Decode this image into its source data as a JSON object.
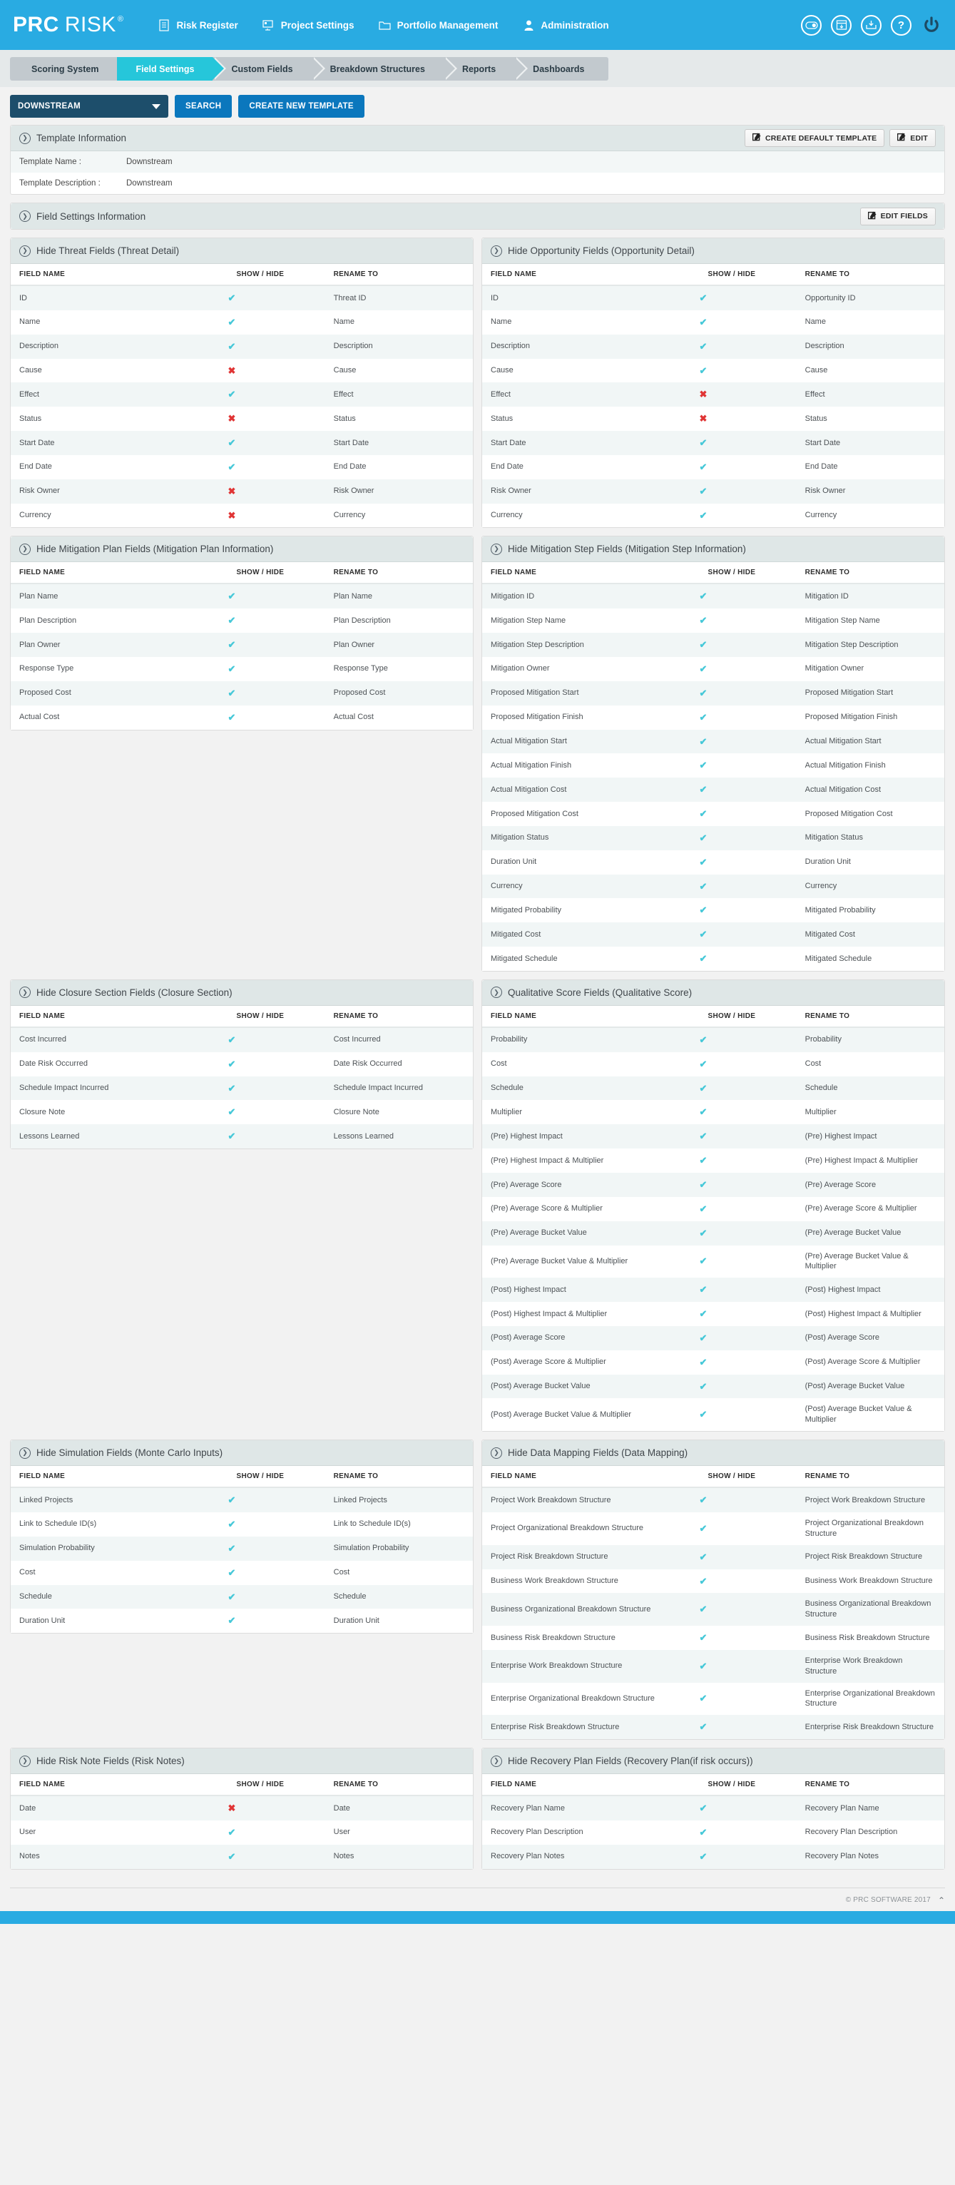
{
  "brand": {
    "part1": "PRC",
    "part2": "RISK",
    "registered": "®"
  },
  "nav": {
    "items": [
      {
        "label": "Risk Register",
        "icon": "document-list-icon"
      },
      {
        "label": "Project Settings",
        "icon": "project-settings-icon"
      },
      {
        "label": "Portfolio Management",
        "icon": "folder-icon"
      },
      {
        "label": "Administration",
        "icon": "user-icon"
      }
    ],
    "tools": [
      {
        "name": "toggle-switch-icon"
      },
      {
        "name": "calendar-download-icon"
      },
      {
        "name": "inbox-download-icon"
      },
      {
        "name": "help-icon"
      },
      {
        "name": "power-icon"
      }
    ]
  },
  "tabs": [
    {
      "label": "Scoring System",
      "active": false
    },
    {
      "label": "Field Settings",
      "active": true
    },
    {
      "label": "Custom Fields",
      "active": false
    },
    {
      "label": "Breakdown Structures",
      "active": false
    },
    {
      "label": "Reports",
      "active": false
    },
    {
      "label": "Dashboards",
      "active": false
    }
  ],
  "actionbar": {
    "selected_template": "DOWNSTREAM",
    "search_label": "SEARCH",
    "create_label": "CREATE NEW TEMPLATE"
  },
  "template_info": {
    "title": "Template Information",
    "create_default_label": "CREATE DEFAULT TEMPLATE",
    "edit_label": "EDIT",
    "rows": [
      {
        "label": "Template Name :",
        "value": "Downstream"
      },
      {
        "label": "Template Description :",
        "value": "Downstream"
      }
    ]
  },
  "field_settings": {
    "title": "Field Settings Information",
    "edit_fields_label": "EDIT FIELDS"
  },
  "columns": [
    "FIELD NAME",
    "SHOW / HIDE",
    "RENAME TO"
  ],
  "sections": [
    {
      "id": "threat",
      "title": "Hide Threat Fields (Threat Detail)",
      "rows": [
        {
          "field": "ID",
          "show": true,
          "rename": "Threat ID"
        },
        {
          "field": "Name",
          "show": true,
          "rename": "Name"
        },
        {
          "field": "Description",
          "show": true,
          "rename": "Description"
        },
        {
          "field": "Cause",
          "show": false,
          "rename": "Cause"
        },
        {
          "field": "Effect",
          "show": true,
          "rename": "Effect"
        },
        {
          "field": "Status",
          "show": false,
          "rename": "Status"
        },
        {
          "field": "Start Date",
          "show": true,
          "rename": "Start Date"
        },
        {
          "field": "End Date",
          "show": true,
          "rename": "End Date"
        },
        {
          "field": "Risk Owner",
          "show": false,
          "rename": "Risk Owner"
        },
        {
          "field": "Currency",
          "show": false,
          "rename": "Currency"
        }
      ]
    },
    {
      "id": "opportunity",
      "title": "Hide Opportunity Fields (Opportunity Detail)",
      "rows": [
        {
          "field": "ID",
          "show": true,
          "rename": "Opportunity ID"
        },
        {
          "field": "Name",
          "show": true,
          "rename": "Name"
        },
        {
          "field": "Description",
          "show": true,
          "rename": "Description"
        },
        {
          "field": "Cause",
          "show": true,
          "rename": "Cause"
        },
        {
          "field": "Effect",
          "show": false,
          "rename": "Effect"
        },
        {
          "field": "Status",
          "show": false,
          "rename": "Status"
        },
        {
          "field": "Start Date",
          "show": true,
          "rename": "Start Date"
        },
        {
          "field": "End Date",
          "show": true,
          "rename": "End Date"
        },
        {
          "field": "Risk Owner",
          "show": true,
          "rename": "Risk Owner"
        },
        {
          "field": "Currency",
          "show": true,
          "rename": "Currency"
        }
      ]
    },
    {
      "id": "mitigation-plan",
      "title": "Hide Mitigation Plan Fields (Mitigation Plan Information)",
      "rows": [
        {
          "field": "Plan Name",
          "show": true,
          "rename": "Plan Name"
        },
        {
          "field": "Plan Description",
          "show": true,
          "rename": "Plan Description"
        },
        {
          "field": "Plan Owner",
          "show": true,
          "rename": "Plan Owner"
        },
        {
          "field": "Response Type",
          "show": true,
          "rename": "Response Type"
        },
        {
          "field": "Proposed Cost",
          "show": true,
          "rename": "Proposed Cost"
        },
        {
          "field": "Actual Cost",
          "show": true,
          "rename": "Actual Cost"
        }
      ]
    },
    {
      "id": "mitigation-step",
      "title": "Hide Mitigation Step Fields (Mitigation Step Information)",
      "rows": [
        {
          "field": "Mitigation ID",
          "show": true,
          "rename": "Mitigation ID"
        },
        {
          "field": "Mitigation Step Name",
          "show": true,
          "rename": "Mitigation Step Name"
        },
        {
          "field": "Mitigation Step Description",
          "show": true,
          "rename": "Mitigation Step Description"
        },
        {
          "field": "Mitigation Owner",
          "show": true,
          "rename": "Mitigation Owner"
        },
        {
          "field": "Proposed Mitigation Start",
          "show": true,
          "rename": "Proposed Mitigation Start"
        },
        {
          "field": "Proposed Mitigation Finish",
          "show": true,
          "rename": "Proposed Mitigation Finish"
        },
        {
          "field": "Actual Mitigation Start",
          "show": true,
          "rename": "Actual Mitigation Start"
        },
        {
          "field": "Actual Mitigation Finish",
          "show": true,
          "rename": "Actual Mitigation Finish"
        },
        {
          "field": "Actual Mitigation Cost",
          "show": true,
          "rename": "Actual Mitigation Cost"
        },
        {
          "field": "Proposed Mitigation Cost",
          "show": true,
          "rename": "Proposed Mitigation Cost"
        },
        {
          "field": "Mitigation Status",
          "show": true,
          "rename": "Mitigation Status"
        },
        {
          "field": "Duration Unit",
          "show": true,
          "rename": "Duration Unit"
        },
        {
          "field": "Currency",
          "show": true,
          "rename": "Currency"
        },
        {
          "field": "Mitigated Probability",
          "show": true,
          "rename": "Mitigated Probability"
        },
        {
          "field": "Mitigated Cost",
          "show": true,
          "rename": "Mitigated Cost"
        },
        {
          "field": "Mitigated Schedule",
          "show": true,
          "rename": "Mitigated Schedule"
        }
      ]
    },
    {
      "id": "closure-section",
      "title": "Hide Closure Section Fields (Closure Section)",
      "rows": [
        {
          "field": "Cost Incurred",
          "show": true,
          "rename": "Cost Incurred"
        },
        {
          "field": "Date Risk Occurred",
          "show": true,
          "rename": "Date Risk Occurred"
        },
        {
          "field": "Schedule Impact Incurred",
          "show": true,
          "rename": "Schedule Impact Incurred"
        },
        {
          "field": "Closure Note",
          "show": true,
          "rename": "Closure Note"
        },
        {
          "field": "Lessons Learned",
          "show": true,
          "rename": "Lessons Learned"
        }
      ]
    },
    {
      "id": "qualitative-score",
      "title": "Qualitative Score Fields (Qualitative Score)",
      "rows": [
        {
          "field": "Probability",
          "show": true,
          "rename": "Probability"
        },
        {
          "field": "Cost",
          "show": true,
          "rename": "Cost"
        },
        {
          "field": "Schedule",
          "show": true,
          "rename": "Schedule"
        },
        {
          "field": "Multiplier",
          "show": true,
          "rename": "Multiplier"
        },
        {
          "field": "(Pre) Highest Impact",
          "show": true,
          "rename": "(Pre) Highest Impact"
        },
        {
          "field": "(Pre) Highest Impact & Multiplier",
          "show": true,
          "rename": "(Pre) Highest Impact & Multiplier"
        },
        {
          "field": "(Pre) Average Score",
          "show": true,
          "rename": "(Pre) Average Score"
        },
        {
          "field": "(Pre) Average Score & Multiplier",
          "show": true,
          "rename": "(Pre) Average Score & Multiplier"
        },
        {
          "field": "(Pre) Average Bucket Value",
          "show": true,
          "rename": "(Pre) Average Bucket Value"
        },
        {
          "field": "(Pre) Average Bucket Value & Multiplier",
          "show": true,
          "rename": "(Pre) Average Bucket Value & Multiplier"
        },
        {
          "field": "(Post) Highest Impact",
          "show": true,
          "rename": "(Post) Highest Impact"
        },
        {
          "field": "(Post) Highest Impact & Multiplier",
          "show": true,
          "rename": "(Post) Highest Impact & Multiplier"
        },
        {
          "field": "(Post) Average Score",
          "show": true,
          "rename": "(Post) Average Score"
        },
        {
          "field": "(Post) Average Score & Multiplier",
          "show": true,
          "rename": "(Post) Average Score & Multiplier"
        },
        {
          "field": "(Post) Average Bucket Value",
          "show": true,
          "rename": "(Post) Average Bucket Value"
        },
        {
          "field": "(Post) Average Bucket Value & Multiplier",
          "show": true,
          "rename": "(Post) Average Bucket Value & Multiplier"
        }
      ]
    },
    {
      "id": "simulation",
      "title": "Hide Simulation Fields (Monte Carlo Inputs)",
      "rows": [
        {
          "field": "Linked Projects",
          "show": true,
          "rename": "Linked Projects"
        },
        {
          "field": "Link to Schedule ID(s)",
          "show": true,
          "rename": "Link to Schedule ID(s)"
        },
        {
          "field": "Simulation Probability",
          "show": true,
          "rename": "Simulation Probability"
        },
        {
          "field": "Cost",
          "show": true,
          "rename": "Cost"
        },
        {
          "field": "Schedule",
          "show": true,
          "rename": "Schedule"
        },
        {
          "field": "Duration Unit",
          "show": true,
          "rename": "Duration Unit"
        }
      ]
    },
    {
      "id": "data-mapping",
      "title": "Hide Data Mapping Fields (Data Mapping)",
      "rows": [
        {
          "field": "Project Work Breakdown Structure",
          "show": true,
          "rename": "Project Work Breakdown Structure"
        },
        {
          "field": "Project Organizational Breakdown Structure",
          "show": true,
          "rename": "Project Organizational Breakdown Structure"
        },
        {
          "field": "Project Risk Breakdown Structure",
          "show": true,
          "rename": "Project Risk Breakdown Structure"
        },
        {
          "field": "Business Work Breakdown Structure",
          "show": true,
          "rename": "Business Work Breakdown Structure"
        },
        {
          "field": "Business Organizational Breakdown Structure",
          "show": true,
          "rename": "Business Organizational Breakdown Structure"
        },
        {
          "field": "Business Risk Breakdown Structure",
          "show": true,
          "rename": "Business Risk Breakdown Structure"
        },
        {
          "field": "Enterprise Work Breakdown Structure",
          "show": true,
          "rename": "Enterprise Work Breakdown Structure"
        },
        {
          "field": "Enterprise Organizational Breakdown Structure",
          "show": true,
          "rename": "Enterprise Organizational Breakdown Structure"
        },
        {
          "field": "Enterprise Risk Breakdown Structure",
          "show": true,
          "rename": "Enterprise Risk Breakdown Structure"
        }
      ]
    },
    {
      "id": "risk-notes",
      "title": "Hide Risk Note Fields (Risk Notes)",
      "rows": [
        {
          "field": "Date",
          "show": false,
          "rename": "Date"
        },
        {
          "field": "User",
          "show": true,
          "rename": "User"
        },
        {
          "field": "Notes",
          "show": true,
          "rename": "Notes"
        }
      ]
    },
    {
      "id": "recovery-plan",
      "title": "Hide Recovery Plan Fields (Recovery Plan(if risk occurs))",
      "rows": [
        {
          "field": "Recovery Plan Name",
          "show": true,
          "rename": "Recovery Plan Name"
        },
        {
          "field": "Recovery Plan Description",
          "show": true,
          "rename": "Recovery Plan Description"
        },
        {
          "field": "Recovery Plan Notes",
          "show": true,
          "rename": "Recovery Plan Notes"
        }
      ]
    }
  ],
  "footer": {
    "copyright": "© PRC SOFTWARE 2017",
    "scroll_top_icon": "chevron-up-icon"
  },
  "glyphs": {
    "tick": "✔",
    "cross": "✖",
    "chevron_right": "❯",
    "chevron_up": "⌃"
  },
  "colors": {
    "brand_blue": "#29abe2",
    "accent_cyan": "#26c6da",
    "tick_green": "#46c8d8",
    "cross_red": "#e03434",
    "dark_navy": "#1d4e6b",
    "button_blue": "#0b77bd"
  }
}
